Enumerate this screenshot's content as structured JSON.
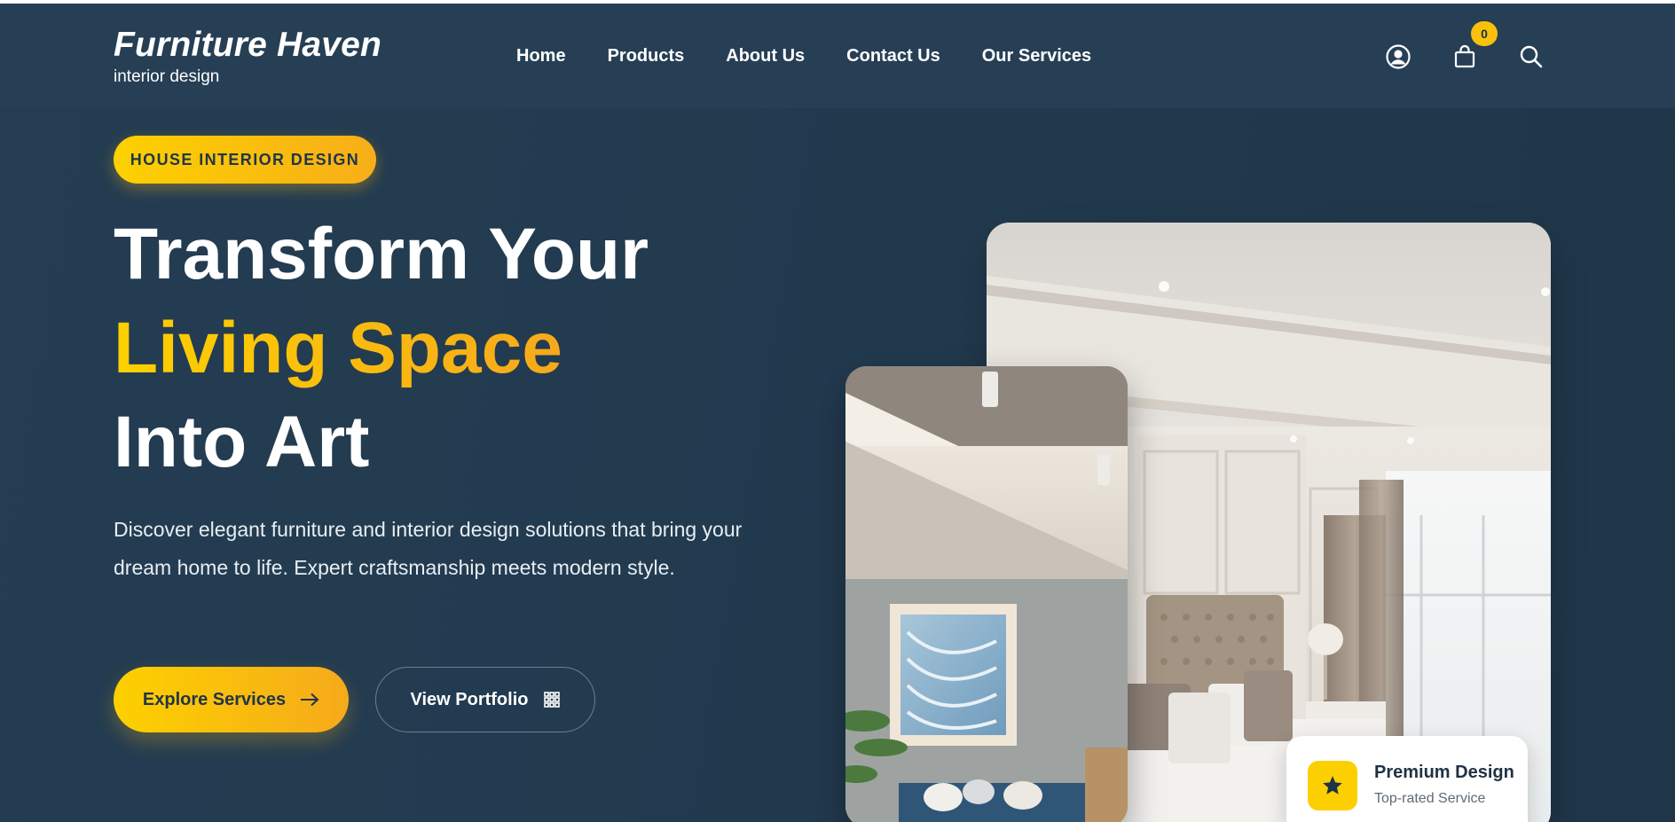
{
  "brand": {
    "name": "Furniture Haven",
    "tagline": "interior design"
  },
  "nav": {
    "items": [
      {
        "label": "Home"
      },
      {
        "label": "Products"
      },
      {
        "label": "About Us"
      },
      {
        "label": "Contact Us"
      },
      {
        "label": "Our Services"
      }
    ]
  },
  "header_icons": {
    "account": "user-circle-icon",
    "cart": "shopping-bag-icon",
    "search": "search-icon",
    "cart_count": "0"
  },
  "hero": {
    "tag": "HOUSE INTERIOR DESIGN",
    "headline_line1": "Transform Your",
    "headline_line2": "Living Space",
    "headline_line3": "Into Art",
    "description": "Discover elegant furniture and interior design solutions that bring your dream home to life. Expert craftsmanship meets modern style.",
    "primary_button": "Explore Services",
    "secondary_button": "View Portfolio"
  },
  "feature_badge": {
    "title": "Premium Design",
    "subtitle": "Top-rated Service",
    "icon": "star-icon"
  },
  "colors": {
    "background": "#223a4e",
    "header": "#263f55",
    "accent": "#fdd100",
    "accent_end": "#f6a91b"
  }
}
